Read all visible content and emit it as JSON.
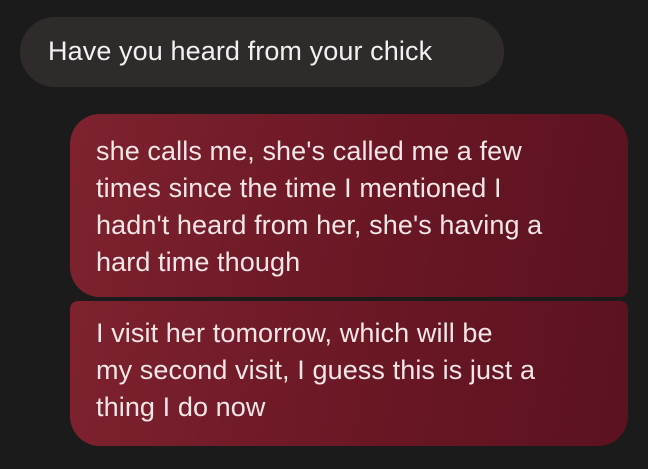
{
  "conversation": {
    "incoming": [
      {
        "lines": [
          "Have you heard from your chick"
        ]
      }
    ],
    "outgoing": [
      {
        "lines": [
          "she calls me, she's called me a few",
          "times since the time I mentioned I",
          "hadn't heard from her, she's having a",
          "hard time though"
        ]
      },
      {
        "lines": [
          "I visit her tomorrow, which will be",
          "my second visit, I guess this is just a",
          "thing I do now"
        ]
      }
    ]
  },
  "colors": {
    "background": "#1b1b1b",
    "incoming_bubble": "#2f2b2b",
    "outgoing_bubble": "#6a1724",
    "incoming_text": "#f1f1f1",
    "outgoing_text": "#f4e6e6"
  }
}
